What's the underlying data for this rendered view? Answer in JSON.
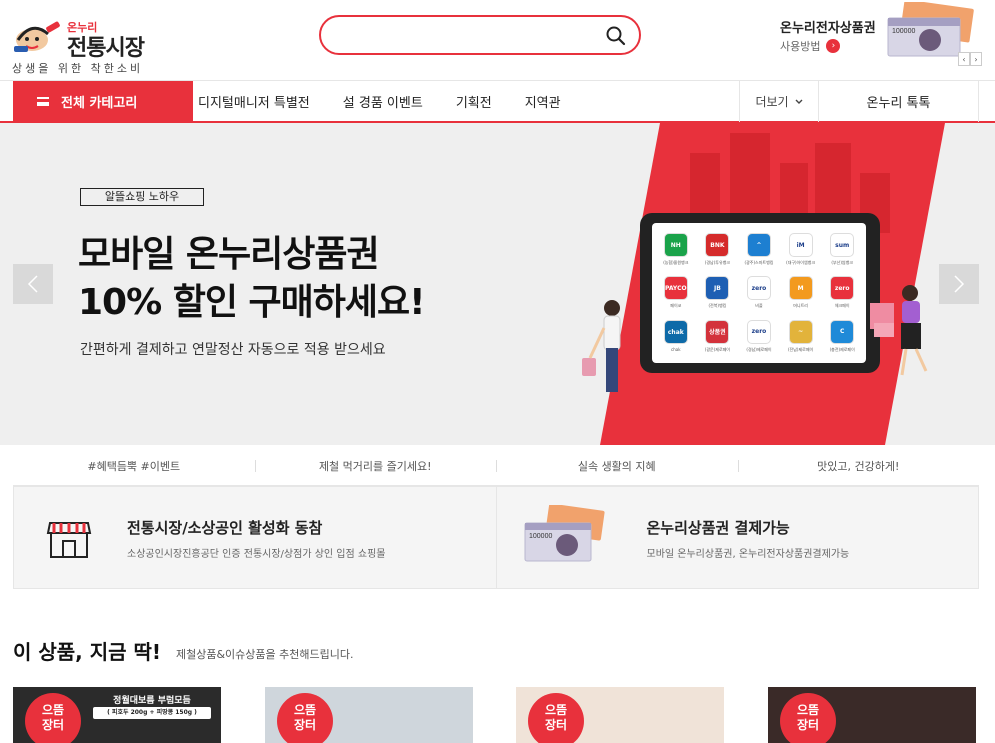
{
  "header": {
    "logo_small": "온누리",
    "logo_title": "전통시장",
    "logo_tagline": "상생을 위한 착한소비",
    "search_placeholder": "",
    "voucher_title": "온누리전자상품권",
    "voucher_link": "사용방법"
  },
  "nav": {
    "category_label": "전체 카테고리",
    "links": [
      "디지털매니저 특별전",
      "설 경품 이벤트",
      "기획전",
      "지역관"
    ],
    "more_label": "더보기",
    "talk_label": "온누리 톡톡"
  },
  "banner": {
    "tag": "알뜰쇼핑 노하우",
    "headline_line1": "모바일 온누리상품권",
    "headline_line2": "10% 할인 구매하세요!",
    "subtext": "간편하게 결제하고 연말정산 자동으로 적용 받으세요",
    "apps": [
      {
        "icon": "NH",
        "label": "(농협)올원뱅크",
        "color": "#1aa34a"
      },
      {
        "icon": "BNK",
        "label": "(경남)투유뱅크",
        "color": "#d52b2b"
      },
      {
        "icon": "^",
        "label": "(광주)스마트뱅킹",
        "color": "#1d7fd1"
      },
      {
        "icon": "iM",
        "label": "(대구)아이엠뱅크",
        "color": "#ffffff"
      },
      {
        "icon": "sum",
        "label": "(부산)썸뱅크",
        "color": "#ffffff"
      },
      {
        "icon": "PAYCO",
        "label": "페이코",
        "color": "#e8313c"
      },
      {
        "icon": "JB",
        "label": "(전북)뱅킹",
        "color": "#1e5fb3"
      },
      {
        "icon": "zero",
        "label": "비플",
        "color": "#ffffff"
      },
      {
        "icon": "M",
        "label": "머니트리",
        "color": "#f39a1e"
      },
      {
        "icon": "zero",
        "label": "체크페이",
        "color": "#e8313c"
      },
      {
        "icon": "chak",
        "label": "chak",
        "color": "#0e6aa8"
      },
      {
        "icon": "상품권",
        "label": "(광운)제로페이",
        "color": "#d3323b"
      },
      {
        "icon": "zero",
        "label": "(경남)제로페이",
        "color": "#ffffff"
      },
      {
        "icon": "~",
        "label": "(전남)제로페이",
        "color": "#e2b33b"
      },
      {
        "icon": "C",
        "label": "(충전)제로페이",
        "color": "#1f8ad8"
      }
    ]
  },
  "tags": [
    "#혜택듬뿍 #이벤트",
    "제철 먹거리를 즐기세요!",
    "실속 생활의 지혜",
    "맛있고, 건강하게!"
  ],
  "features": [
    {
      "title": "전통시장/소상공인 활성화 동참",
      "desc": "소상공인시장진흥공단 인증 전통시장/상점가 상인 입점 쇼핑몰"
    },
    {
      "title": "온누리상품권 결제가능",
      "desc": "모바일 온누리상품권, 온누리전자상품권결제가능"
    }
  ],
  "recommend": {
    "title": "이 상품, 지금 딱!",
    "subtitle": "제철상품&이슈상품을 추천해드립니다.",
    "badge_line1": "으뜸",
    "badge_line2": "장터",
    "products": [
      {
        "label": "정월대보름 부럼모듬",
        "sub": "( 피호두 200g + 피땅콩 150g )",
        "bg": "#2b2b2b"
      },
      {
        "label": "",
        "sub": "",
        "bg": "#cfd6dc"
      },
      {
        "label": "",
        "sub": "",
        "bg": "#f0e3d8"
      },
      {
        "label": "",
        "sub": "",
        "bg": "#3a2a28"
      }
    ]
  },
  "colors": {
    "accent": "#e8313c"
  }
}
